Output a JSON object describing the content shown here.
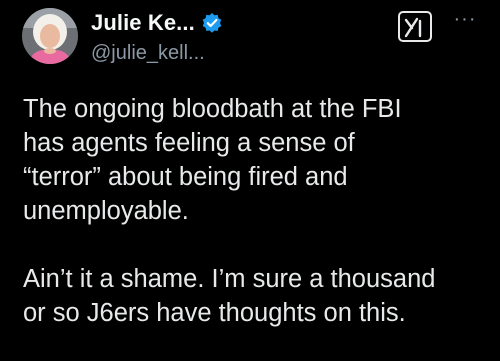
{
  "author": {
    "display_name": "Julie Ke...",
    "handle": "@julie_kell...",
    "verified": true,
    "verified_color": "#1d9bf0"
  },
  "actions": {
    "grok_icon": "grok-icon",
    "more_label": "···"
  },
  "post": {
    "paragraphs": [
      "The ongoing bloodbath at the FBI\nhas agents feeling a sense of\n“terror” about being fired and\nunemployable.",
      "Ain’t it a shame. I’m sure a thousand\nor so J6ers  have thoughts on this."
    ]
  },
  "colors": {
    "background": "#000000",
    "text": "#e7e9ea",
    "secondary": "#8b98a5",
    "accent": "#1d9bf0"
  }
}
